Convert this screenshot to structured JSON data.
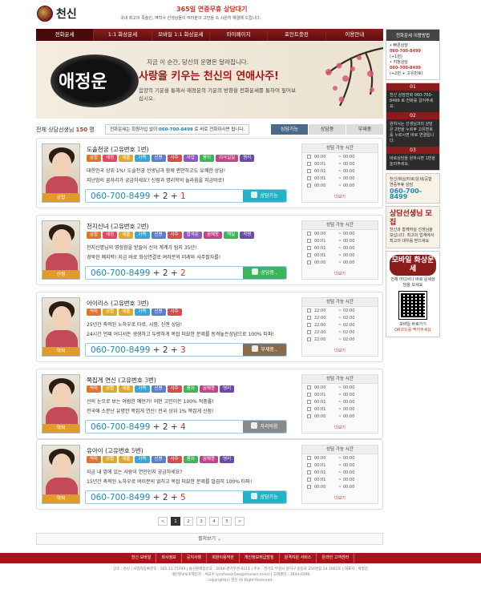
{
  "header": {
    "logo": "천신",
    "promo": "365일 연중무휴 상담대기",
    "sub": "국내 최고의 족술인, 역학사 선생님들이 여러분의 고민을 속 시원히 해결해 드립니다."
  },
  "nav": [
    "전화운세",
    "1:1 화상운세",
    "모바일 1:1 화상운세",
    "마이페이지",
    "포인트충전",
    "이용안내"
  ],
  "banner": {
    "calligraphy": "애정운",
    "line1": "지금 이 순간, 당신의 운명은 달라집니다.",
    "headline": "사랑을 키우는 천신의 연애사주!",
    "line2": "음양의 기운을 통해서 애정운의 기운의 방향을 전화운세를 통하여 짚어보십시오."
  },
  "sidebar": {
    "usage_title": "전화운세 이용방법",
    "fast": "• 빠른상담",
    "fast_phone": "060-700-8499",
    "fast_ext": "(+1번)",
    "designated": "• 지정상담",
    "designated_phone": "060-700-8499",
    "designated_ext": "(+2번 + 고유번호)",
    "steps": [
      {
        "n": "01",
        "text": "천신 상담전화 060-700-8499 로 전화를 걸어주세요."
      },
      {
        "n": "02",
        "text": "원하시는 선생님과의 상담은 2번을 누르후 고유번호를 누르시면 바로 연결됩니다."
      },
      {
        "n": "03",
        "text": "바로상담을 원하시면 1번을 눌러주세요."
      }
    ],
    "card1_text": "천신/화상/타로/운세/공합 연중무휴 상담",
    "card1_phone": "060-700-8499",
    "card2_big": "상담선생님 모집",
    "card2_text": "천신과 함께하실 선생님을 모십니다. 최고의 업계에서 최고의 대우를 받으세요",
    "mobile_big": "모바일 화상운세",
    "mobile_text": "언제 어디서나 바로 운세상담을 보세요",
    "qr_caption": "모바일 바로가기",
    "qr_note": "QR코드를 찍어주세요"
  },
  "bar": {
    "total_label": "전체 상담선생님",
    "total_count": "150",
    "total_unit": "명",
    "note_prefix": "전화운세는 회원가입 없이",
    "note_phone": "060-700-8499",
    "note_suffix": "로 바로 전화하시면 됩니다.",
    "tabs": [
      "상담가능",
      "상담중",
      "부재중"
    ]
  },
  "counselors": [
    {
      "name": "도솔천궁",
      "id_label": "(고유번호",
      "id": "1",
      "id_close": "번)",
      "tag": "궁합",
      "chips": [
        [
          "궁합",
          "#e0732d"
        ],
        [
          "애정",
          "#e2485d"
        ],
        [
          "재물",
          "#e0a92d"
        ],
        [
          "가족",
          "#3aa7d8"
        ],
        [
          "신병",
          "#5a7fd0"
        ],
        [
          "사주",
          "#d84e4e"
        ],
        [
          "사업",
          "#8a5bc4"
        ],
        [
          "풍이",
          "#3db55a"
        ],
        [
          "이사길일",
          "#c4448a"
        ],
        [
          "명리",
          "#6b4ba8"
        ]
      ],
      "desc1": "대한민국 상위 1%! 도솔천궁 선생님과 함께 편안하고도 유쾌한 상담!",
      "desc2": "지난밤의 꿈자리가 궁금하세요? 신점과 명리학의 놀라움을 지금바로!",
      "phone": "060-700-8499",
      "plus": "+ 2 +",
      "ext": "1",
      "status": "상담가능",
      "status_class": "st-ok",
      "times": [
        [
          "00:00",
          "00:00"
        ],
        [
          "00:01",
          "00:00"
        ],
        [
          "00:01",
          "00:00"
        ],
        [
          "00:01",
          "00:00"
        ],
        [
          "00:00",
          "00:00"
        ]
      ],
      "more": "더보기"
    },
    {
      "name": "천지신녀",
      "id_label": "(고유번호",
      "id": "2",
      "id_close": "번)",
      "tag": "신점",
      "chips": [
        [
          "궁합",
          "#e0732d"
        ],
        [
          "애정",
          "#e2485d"
        ],
        [
          "재물",
          "#e0a92d"
        ],
        [
          "가족",
          "#3aa7d8"
        ],
        [
          "신병",
          "#5a7fd0"
        ],
        [
          "사주",
          "#d84e4e"
        ],
        [
          "합격운",
          "#8a5bc4"
        ],
        [
          "꿈해몽",
          "#c4448a"
        ],
        [
          "택일",
          "#3db55a"
        ],
        [
          "작명",
          "#6b4ba8"
        ]
      ],
      "desc1": "천지신명님의 영험함을 받들어 신의 계계가 됨지 35년!",
      "desc2": "경북한 예지력! 지금 바로 화상연결로 여러분의 미래와 사주팔자를!",
      "phone": "060-700-8499",
      "plus": "+ 2 +",
      "ext": "2",
      "status": "상담중..",
      "status_class": "st-busy",
      "times": [
        [
          "00:00",
          "00:00"
        ],
        [
          "00:01",
          "00:00"
        ],
        [
          "00:01",
          "00:00"
        ],
        [
          "00:01",
          "00:00"
        ],
        [
          "00:00",
          "00:00"
        ]
      ],
      "more": "더보기"
    },
    {
      "name": "아이리스",
      "id_label": "(고유번호",
      "id": "3",
      "id_close": "번)",
      "tag": "역학",
      "chips": [
        [
          "역학",
          "#e0732d"
        ],
        [
          "궁합",
          "#e0a92d"
        ],
        [
          "재물",
          "#e0a92d"
        ],
        [
          "가족",
          "#3aa7d8"
        ],
        [
          "신병",
          "#5a7fd0"
        ],
        [
          "사주",
          "#d84e4e"
        ]
      ],
      "desc1": "25년간 축적된 노하우로 타로, 시점, 신앤 상담!",
      "desc2": "24시간 언제 어디서든 생생하고 두렷하게 복잡 미묘한 문제를 동격놓은상담으로 100% 타파!",
      "phone": "060-700-8499",
      "plus": "+ 2 +",
      "ext": "3",
      "status": "부재중..",
      "status_class": "st-away",
      "times": [
        [
          "22:00",
          "02:00"
        ],
        [
          "22:00",
          "02:00"
        ],
        [
          "22:00",
          "02:00"
        ],
        [
          "22:00",
          "02:00"
        ],
        [
          "22:00",
          "02:00"
        ]
      ],
      "more": "더보기"
    },
    {
      "name": "쪽집게 연신",
      "id_label": "(고유번호",
      "id": "3",
      "id_close": "번)",
      "tag": "역학",
      "chips": [
        [
          "역학",
          "#e0732d"
        ],
        [
          "궁합",
          "#e0a92d"
        ],
        [
          "재물",
          "#e0a92d"
        ],
        [
          "가족",
          "#3aa7d8"
        ],
        [
          "신병",
          "#5a7fd0"
        ],
        [
          "사주",
          "#d84e4e"
        ],
        [
          "풍이",
          "#3db55a"
        ],
        [
          "꿈해몽",
          "#c4448a"
        ],
        [
          "명리",
          "#6b4ba8"
        ]
      ],
      "desc1": "신의 눈으로 보는 여럼한 예언가! 어떤 고민이든 100% 적중률!",
      "desc2": "전국에 소문난 유명한 쪽집게 연신! 전국 상위 1% 쪽집게 신점!",
      "phone": "060-700-8499",
      "plus": "+ 2 +",
      "ext": "4",
      "status": "자리비움",
      "status_class": "st-rest",
      "times": [
        [
          "00:00",
          "00:00"
        ],
        [
          "00:01",
          "00:00"
        ],
        [
          "00:01",
          "00:00"
        ],
        [
          "00:01",
          "00:00"
        ],
        [
          "00:00",
          "00:00"
        ]
      ],
      "more": "더보기"
    },
    {
      "name": "유아이",
      "id_label": "(고유번호",
      "id": "5",
      "id_close": "번)",
      "tag": "역학",
      "chips": [
        [
          "역학",
          "#e0732d"
        ],
        [
          "궁합",
          "#e0a92d"
        ],
        [
          "재물",
          "#e0a92d"
        ],
        [
          "가족",
          "#3aa7d8"
        ],
        [
          "신병",
          "#5a7fd0"
        ],
        [
          "사주",
          "#d84e4e"
        ],
        [
          "풍이",
          "#3db55a"
        ],
        [
          "꿈해몽",
          "#c4448a"
        ],
        [
          "명리",
          "#6b4ba8"
        ]
      ],
      "desc1": "지금 내 옆에 있는 사람이 연인인지 궁금하세요?",
      "desc2": "15년간 축적된 노하우로 여러분의 얽히고 복잡 미묘한 문제를 말끔히 100% 타파!",
      "phone": "060-700-8499",
      "plus": "+ 2 +",
      "ext": "5",
      "status": "상담가능",
      "status_class": "st-ok",
      "times": [
        [
          "00:00",
          "00:00"
        ],
        [
          "00:01",
          "00:00"
        ],
        [
          "00:01",
          "00:00"
        ],
        [
          "00:01",
          "00:00"
        ],
        [
          "00:00",
          "00:00"
        ]
      ],
      "more": "더보기"
    }
  ],
  "schedule_title": "상담 가능 시간",
  "pagination": [
    "<",
    "1",
    "2",
    "3",
    "4",
    "5",
    ">"
  ],
  "pagination_active": "1",
  "more_all": "펼쳐보기 ⌄",
  "footer": {
    "links": [
      "천신 모바일",
      "회사정보",
      "공지사항",
      "회원이용약관",
      "개인정보취급방침",
      "원격지원 서비스",
      "온라인 고객센터"
    ],
    "line1": "상호 : 천신 | 사업자등록번호 : 105-11-75749 | 통신판매업신고 : 2014-경기부천-0211 | 주소 : 경기도 부천시 원미구 중동로 254번길 24 1002호 | 대표자 : 박병갑",
    "line2": "개인정보보호책임자 : 서교수 (professor5eo@chunsin.co.kr) | 고객센터 : 1644-0190",
    "line3": "copyright(c) 천신 All Right Reserved."
  }
}
